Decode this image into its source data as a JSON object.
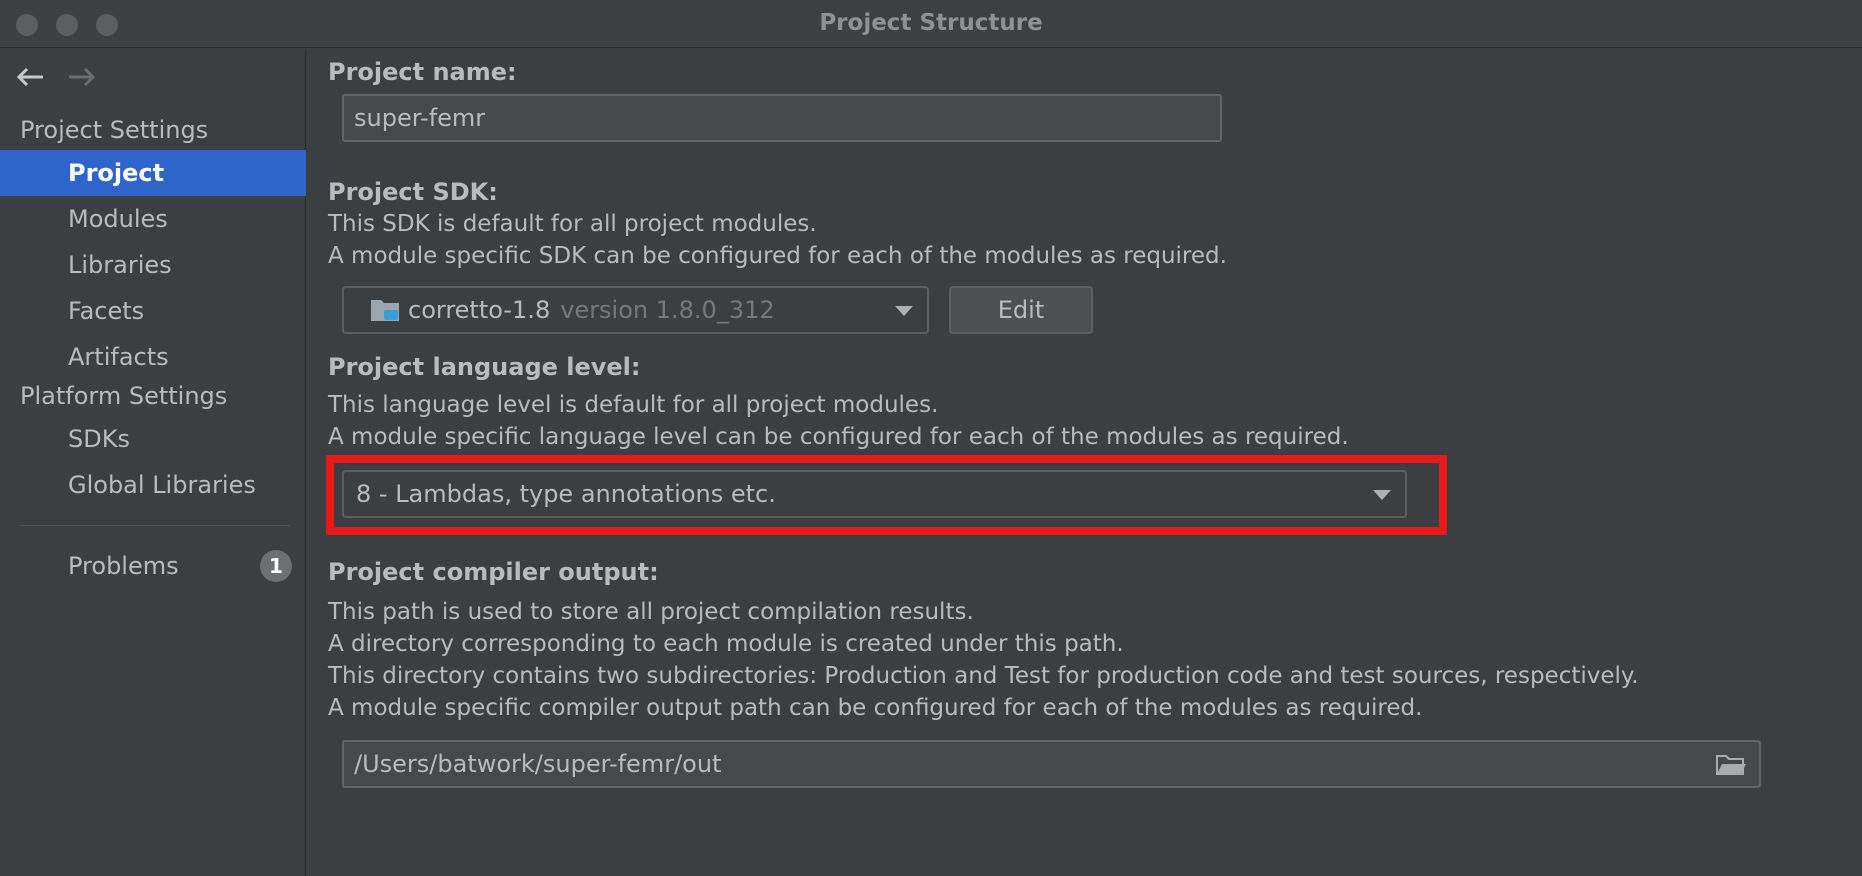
{
  "window": {
    "title": "Project Structure"
  },
  "sidebar": {
    "project_settings_header": "Project Settings",
    "project_items": [
      {
        "label": "Project",
        "selected": true
      },
      {
        "label": "Modules"
      },
      {
        "label": "Libraries"
      },
      {
        "label": "Facets"
      },
      {
        "label": "Artifacts"
      }
    ],
    "platform_settings_header": "Platform Settings",
    "platform_items": [
      {
        "label": "SDKs"
      },
      {
        "label": "Global Libraries"
      }
    ],
    "problems": {
      "label": "Problems",
      "count": "1"
    }
  },
  "main": {
    "project_name": {
      "label": "Project name:",
      "value": "super-femr"
    },
    "sdk": {
      "label": "Project SDK:",
      "desc_line1": "This SDK is default for all project modules.",
      "desc_line2": "A module specific SDK can be configured for each of the modules as required.",
      "selected_name": "corretto-1.8",
      "selected_version": "version 1.8.0_312",
      "edit_button": "Edit"
    },
    "language_level": {
      "label": "Project language level:",
      "desc_line1": "This language level is default for all project modules.",
      "desc_line2": "A module specific language level can be configured for each of the modules as required.",
      "selected": "8 - Lambdas, type annotations etc."
    },
    "compiler_output": {
      "label": "Project compiler output:",
      "desc_line1": "This path is used to store all project compilation results.",
      "desc_line2": "A directory corresponding to each module is created under this path.",
      "desc_line3": "This directory contains two subdirectories: Production and Test for production code and test sources, respectively.",
      "desc_line4": "A module specific compiler output path can be configured for each of the modules as required.",
      "path": "/Users/batwork/super-femr/out"
    }
  },
  "colors": {
    "background": "#3c3f41",
    "selection": "#2f65ca",
    "highlight_box": "#e8191b",
    "text": "#bbbbbb"
  }
}
